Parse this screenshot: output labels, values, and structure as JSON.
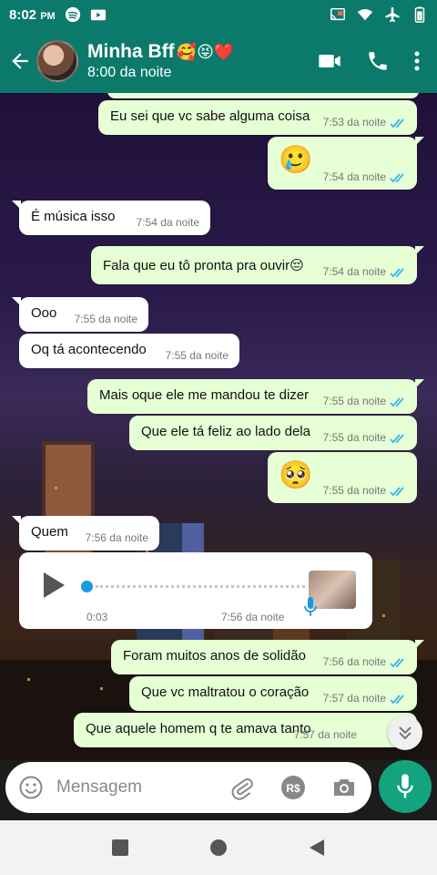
{
  "status_bar": {
    "time": "8:02",
    "ampm": "PM"
  },
  "header": {
    "name": "Minha Bff",
    "name_emojis": "🥰😝❤️",
    "subtitle": "8:00 da noite"
  },
  "messages": [
    {
      "dir": "out",
      "text": "Eu sei que vc sabe alguma coisa",
      "time": "7:53 da noite"
    },
    {
      "dir": "out",
      "text": "🥲",
      "time": "7:54 da noite"
    },
    {
      "dir": "in",
      "text": "É música isso",
      "time": "7:54 da noite"
    },
    {
      "dir": "out",
      "text": "Fala que eu tô pronta pra ouvir😔",
      "time": "7:54 da noite"
    },
    {
      "dir": "in",
      "text": "Ooo",
      "time": "7:55 da noite"
    },
    {
      "dir": "in",
      "text": "Oq tá acontecendo",
      "time": "7:55 da noite"
    },
    {
      "dir": "out",
      "text": "Mais oque ele me mandou te dizer",
      "time": "7:55 da noite"
    },
    {
      "dir": "out",
      "text": "Que ele tá feliz ao lado dela",
      "time": "7:55 da noite"
    },
    {
      "dir": "out",
      "text": "🥺",
      "time": "7:55 da noite"
    },
    {
      "dir": "in",
      "text": "Quem",
      "time": "7:56 da noite"
    },
    {
      "dir": "out",
      "text": "Foram muitos anos de solidão",
      "time": "7:56 da noite"
    },
    {
      "dir": "out",
      "text": "Que vc maltratou o coração",
      "time": "7:57 da noite"
    },
    {
      "dir": "out",
      "text": "Que aquele homem q te amava tanto",
      "time": "7:57 da noite"
    }
  ],
  "audio_message": {
    "duration": "0:03",
    "time": "7:56 da noite"
  },
  "composer": {
    "placeholder": "Mensagem"
  },
  "colors": {
    "header": "#0b7a6a",
    "outgoing": "#e6ffd4",
    "incoming": "#ffffff",
    "tick": "#34b7f1",
    "fab": "#14a37f"
  },
  "icons": [
    "spotify-icon",
    "video-notification-icon",
    "cast-icon",
    "wifi-icon",
    "airplane-icon",
    "battery-icon",
    "back-arrow-icon",
    "video-call-icon",
    "phone-icon",
    "more-vert-icon",
    "play-icon",
    "mic-icon",
    "emoji-icon",
    "attach-icon",
    "payment-icon",
    "camera-icon",
    "double-chevron-down-icon",
    "nav-recents-icon",
    "nav-home-icon",
    "nav-back-icon"
  ]
}
